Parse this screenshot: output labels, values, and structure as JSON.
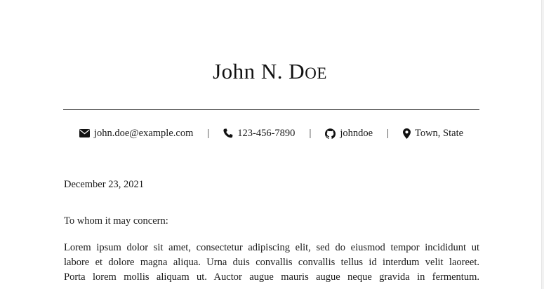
{
  "header": {
    "first_name": "John N. D",
    "last_name_small": "OE"
  },
  "contacts": {
    "email": {
      "icon": "envelope-icon",
      "text": "john.doe@example.com"
    },
    "phone": {
      "icon": "phone-icon",
      "text": "123-456-7890"
    },
    "github": {
      "icon": "github-icon",
      "text": "johndoe"
    },
    "location": {
      "icon": "map-marker-icon",
      "text": "Town, State"
    },
    "separator": "|"
  },
  "letter": {
    "date": "December 23, 2021",
    "salutation": "To whom it may concern:",
    "body_lines": [
      "Lorem ipsum dolor sit amet, consectetur adipiscing elit, sed do eiusmod tempor incididunt ut",
      "labore et dolore magna aliqua.  Urna duis convallis convallis tellus id interdum velit laoreet.",
      "Porta lorem mollis aliquam ut.  Auctor augue mauris augue neque gravida in fermentum."
    ]
  }
}
